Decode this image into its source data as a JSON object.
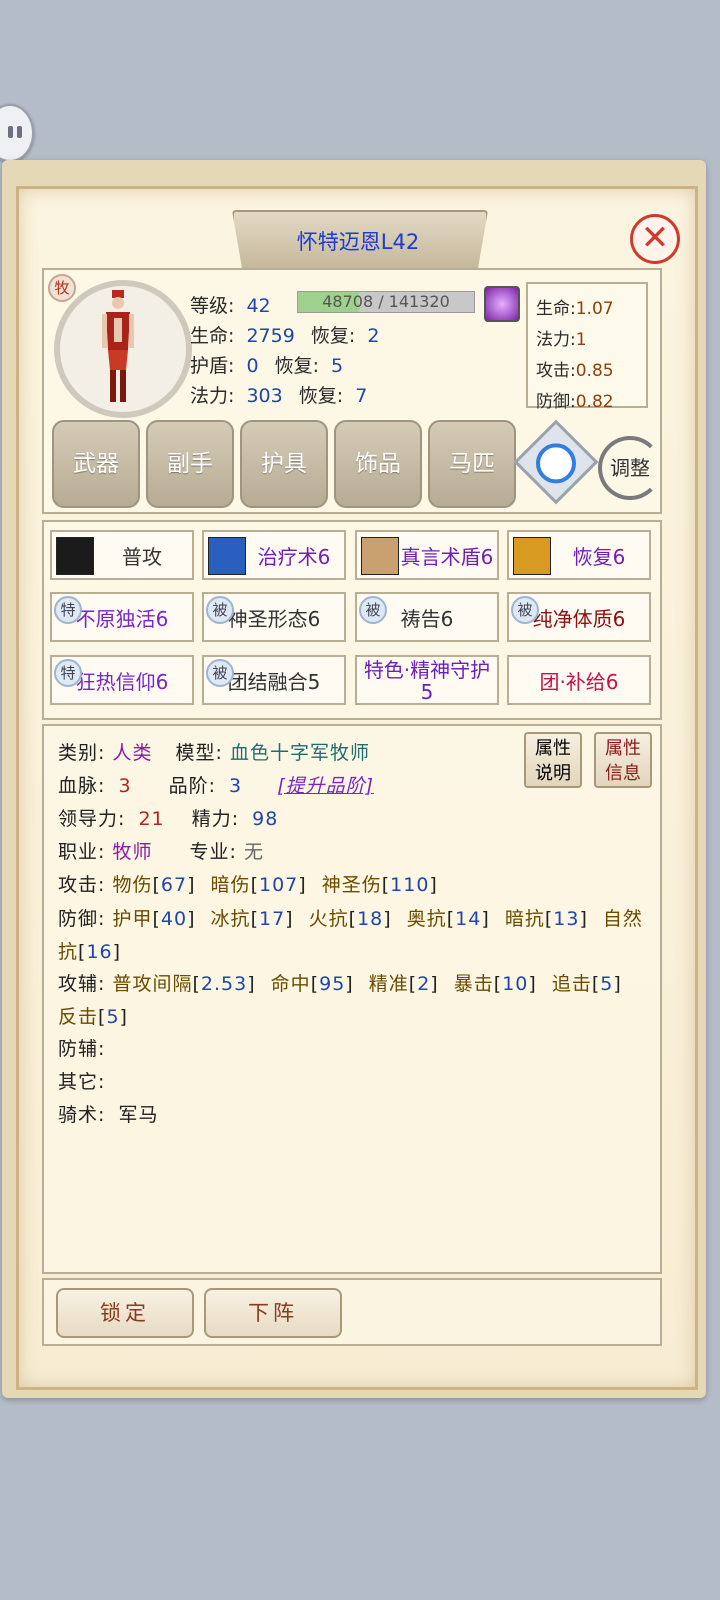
{
  "title": "怀特迈恩L42",
  "close_symbol": "✕",
  "class_badge": "牧",
  "stats": {
    "level_label": "等级:",
    "level": "42",
    "exp_text": "48708 / 141320",
    "exp_progress": 0.345,
    "hp_label": "生命:",
    "hp": "2759",
    "shield_label": "护盾:",
    "shield": "0",
    "mana_label": "法力:",
    "mana": "303",
    "regen_label": "恢复:",
    "hp_regen": "2",
    "shield_regen": "5",
    "mana_regen": "7"
  },
  "coefficients": [
    {
      "label": "生命:",
      "value": "1.07"
    },
    {
      "label": "法力:",
      "value": "1"
    },
    {
      "label": "攻击:",
      "value": "0.85"
    },
    {
      "label": "防御:",
      "value": "0.82"
    }
  ],
  "equipment_tabs": [
    "武器",
    "副手",
    "护具",
    "饰品",
    "马匹"
  ],
  "adjust_label": "调整",
  "skills": [
    {
      "label": "普攻",
      "badge": "",
      "icon": "sword-icon",
      "color": "dark"
    },
    {
      "label": "治疗术6",
      "badge": "",
      "icon": "heal-icon",
      "color": "violet"
    },
    {
      "label": "真言术盾6",
      "badge": "",
      "icon": "shield-spell-icon",
      "color": "violet"
    },
    {
      "label": "恢复6",
      "badge": "",
      "icon": "renew-icon",
      "color": "violet"
    },
    {
      "label": "不原独活6",
      "badge": "特",
      "icon": "",
      "color": "purple"
    },
    {
      "label": "神圣形态6",
      "badge": "被",
      "icon": "",
      "color": "dark"
    },
    {
      "label": "祷告6",
      "badge": "被",
      "icon": "",
      "color": "dark"
    },
    {
      "label": "纯净体质6",
      "badge": "被",
      "icon": "",
      "color": "red"
    },
    {
      "label": "狂热信仰6",
      "badge": "特",
      "icon": "",
      "color": "purple"
    },
    {
      "label": "团结融合5",
      "badge": "被",
      "icon": "",
      "color": "dark"
    },
    {
      "label": "特色·精神守护5",
      "badge": "",
      "icon": "",
      "color": "violet"
    },
    {
      "label": "团·补给6",
      "badge": "",
      "icon": "",
      "color": "crimson"
    }
  ],
  "info": {
    "category_label": "类别:",
    "category": "人类",
    "model_label": "模型:",
    "model": "血色十字军牧师",
    "bloodline_label": "血脉:",
    "bloodline": "3",
    "grade_label": "品阶:",
    "grade": "3",
    "upgrade_link": "[提升品阶]",
    "leadership_label": "领导力:",
    "leadership": "21",
    "energy_label": "精力:",
    "energy": "98",
    "job_label": "职业:",
    "job": "牧师",
    "spec_label": "专业:",
    "spec": "无",
    "attack_label": "攻击:",
    "defense_label": "防御:",
    "attack_aux_label": "攻辅:",
    "defense_aux_label": "防辅:",
    "other_label": "其它:",
    "riding_label": "骑术:",
    "riding": "军马"
  },
  "attack_stats": [
    {
      "name": "物伤",
      "value": "67"
    },
    {
      "name": "暗伤",
      "value": "107"
    },
    {
      "name": "神圣伤",
      "value": "110"
    }
  ],
  "defense_stats": [
    {
      "name": "护甲",
      "value": "40"
    },
    {
      "name": "冰抗",
      "value": "17"
    },
    {
      "name": "火抗",
      "value": "18"
    },
    {
      "name": "奥抗",
      "value": "14"
    },
    {
      "name": "暗抗",
      "value": "13"
    },
    {
      "name": "自然抗",
      "value": "16"
    }
  ],
  "attack_aux_stats": [
    {
      "name": "普攻间隔",
      "value": "2.53"
    },
    {
      "name": "命中",
      "value": "95"
    },
    {
      "name": "精准",
      "value": "2"
    },
    {
      "name": "暴击",
      "value": "10"
    },
    {
      "name": "追击",
      "value": "5"
    },
    {
      "name": "反击",
      "value": "5"
    }
  ],
  "attr_buttons": [
    {
      "line1": "属性",
      "line2": "说明"
    },
    {
      "line1": "属性",
      "line2": "信息"
    }
  ],
  "bottom_buttons": [
    "锁定",
    "下阵"
  ]
}
